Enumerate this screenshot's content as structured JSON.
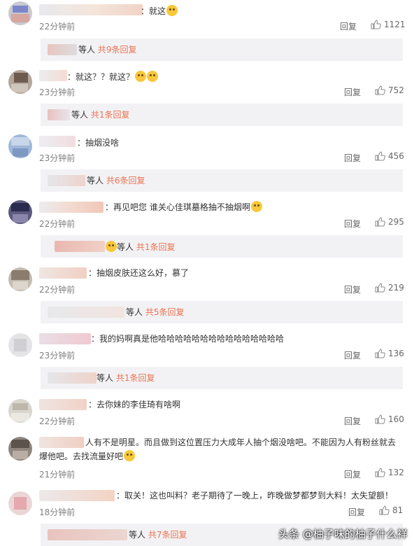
{
  "reply_label": "回复",
  "comments": [
    {
      "text": "：就这",
      "time": "22分钟前",
      "likes": "1121",
      "sub_deng": "等人",
      "sub_count": "共9条回复"
    },
    {
      "text": "：就这？？就这？",
      "time": "23分钟前",
      "likes": "752",
      "sub_deng": "等人",
      "sub_count": "共1条回复"
    },
    {
      "text": "：抽烟没啥",
      "time": "23分钟前",
      "likes": "456",
      "sub_deng": "等人",
      "sub_count": "共6条回复"
    },
    {
      "text": "：再见吧您 谁关心佳琪墓格抽不抽烟啊",
      "time": "22分钟前",
      "likes": "295",
      "sub_deng": "等人",
      "sub_count": "共1条回复"
    },
    {
      "text": "：抽烟皮肤还这么好，慕了",
      "time": "22分钟前",
      "likes": "219",
      "sub_deng": "等人",
      "sub_count": "共5条回复"
    },
    {
      "text": "：我的妈啊真是他哈哈哈哈哈哈哈哈哈哈哈哈哈哈哈",
      "time": "23分钟前",
      "likes": "136",
      "sub_deng": "等人",
      "sub_count": "共1条回复"
    },
    {
      "text": "：去你妹的李佳琦有啥啊",
      "time": "22分钟前",
      "likes": "160",
      "sub_deng": "",
      "sub_count": ""
    },
    {
      "text": "人有不是明星。而且做到这位置压力大成年人抽个烟没啥吧。不能因为人有粉丝就去爆他吧。去找流量好吧",
      "time": "21分钟前",
      "likes": "132",
      "sub_deng": "",
      "sub_count": ""
    },
    {
      "text": "：取关！这也叫料？老子期待了一晚上，昨晚做梦都梦到大料！太失望额！",
      "time": "18分钟前",
      "likes": "81",
      "sub_deng": "等人",
      "sub_count": "共7条回复"
    }
  ],
  "watermark": "头条 @柚子味的柚子什么祥",
  "colors": {
    "accent": "#eb7350",
    "subbar_bg": "#f2f2f5",
    "time": "#808080"
  }
}
